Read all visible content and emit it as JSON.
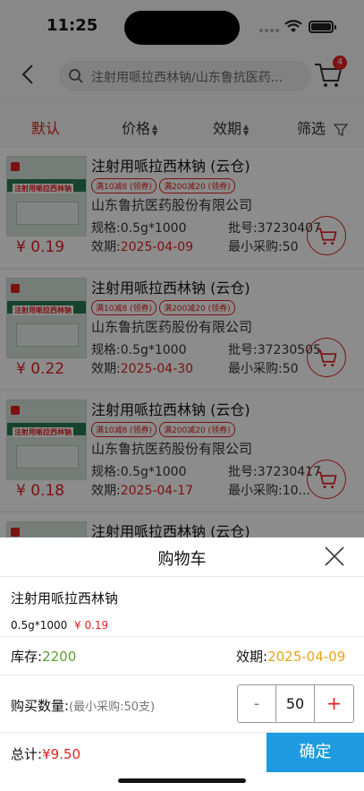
{
  "status": {
    "time": "11:25"
  },
  "nav": {
    "search_text": "注射用哌拉西林钠/山东鲁抗医药...",
    "cart_badge": "4"
  },
  "sort": {
    "default": "默认",
    "price": "价格",
    "expiry": "效期",
    "filter": "筛选"
  },
  "products": [
    {
      "title": "注射用哌拉西林钠 (云仓)",
      "coupons": [
        "满10减8 (领券)",
        "满200减20 (领券)"
      ],
      "manufacturer": "山东鲁抗医药股份有限公司",
      "spec": "规格:0.5g*1000",
      "lot": "批号:37230407",
      "expiry_label": "效期:",
      "expiry": "2025-04-09",
      "min_buy": "最小采购:50",
      "price": "¥ 0.19"
    },
    {
      "title": "注射用哌拉西林钠 (云仓)",
      "coupons": [
        "满10减8 (领券)",
        "满200减20 (领券)"
      ],
      "manufacturer": "山东鲁抗医药股份有限公司",
      "spec": "规格:0.5g*1000",
      "lot": "批号:37230505",
      "expiry_label": "效期:",
      "expiry": "2025-04-30",
      "min_buy": "最小采购:50",
      "price": "¥ 0.22"
    },
    {
      "title": "注射用哌拉西林钠 (云仓)",
      "coupons": [
        "满10减8 (领券)",
        "满200减20 (领券)"
      ],
      "manufacturer": "山东鲁抗医药股份有限公司",
      "spec": "规格:0.5g*1000",
      "lot": "批号:37230417",
      "expiry_label": "效期:",
      "expiry": "2025-04-17",
      "min_buy": "最小采购:10...",
      "price": "¥ 0.18"
    },
    {
      "title": "注射用哌拉西林钠 (云仓)"
    }
  ],
  "sheet": {
    "title": "购物车",
    "product_name": "注射用哌拉西林钠",
    "spec": "0.5g*1000",
    "price": "¥ 0.19",
    "stock_label": "库存:",
    "stock": "2200",
    "expiry_label": "效期:",
    "expiry": "2025-04-09",
    "qty_label": "购买数量:",
    "qty_hint": "(最小采购:50支)",
    "minus": "-",
    "quantity": "50",
    "plus": "+",
    "total_label": "总计:",
    "total": "¥9.50",
    "confirm": "确定"
  },
  "colors": {
    "accent": "#e02020",
    "confirm": "#1e9be0",
    "stock": "#5a9e2d",
    "expiry": "#e8a317"
  }
}
